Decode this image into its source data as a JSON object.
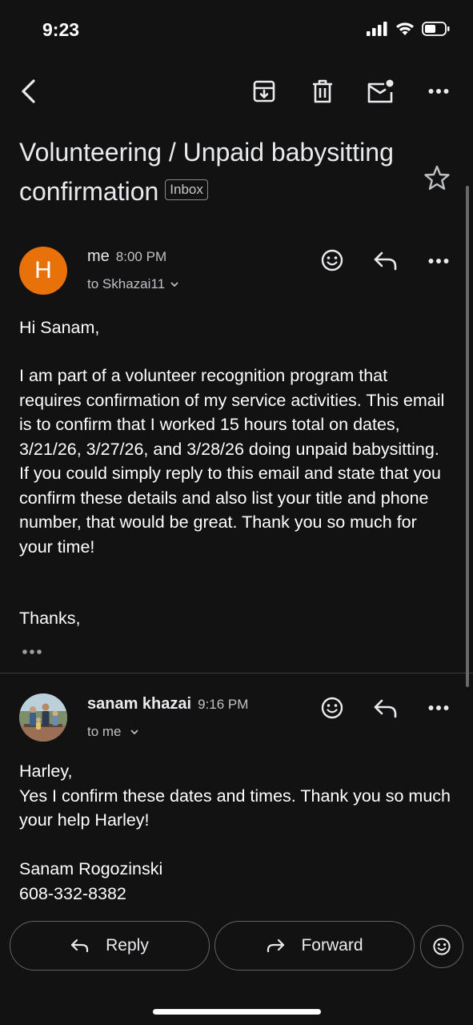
{
  "status_bar": {
    "time": "9:23"
  },
  "toolbar": {
    "icons": [
      "back-arrow-icon",
      "archive-icon",
      "trash-icon",
      "mark-unread-icon",
      "more-icon"
    ]
  },
  "subject": {
    "title": "Volunteering / Unpaid babysitting confirmation",
    "label_badge": "Inbox"
  },
  "messages": [
    {
      "avatar_letter": "H",
      "avatar_color": "#e8710a",
      "sender": "me",
      "time": "8:00 PM",
      "recipient": "to Skhazai11",
      "greeting": "Hi Sanam,",
      "body": "I am part of a volunteer recognition program that requires confirmation of my service activities. This email is to confirm that I worked 15 hours total on dates, 3/21/26, 3/27/26, and 3/28/26 doing unpaid babysitting. If you could simply reply to this email and state that you confirm these details and also list your title and phone number, that would be great. Thank you so much for your time!",
      "signoff": "Thanks,"
    },
    {
      "sender": "sanam khazai",
      "time": "9:16 PM",
      "recipient": "to me",
      "body": "Harley,\nYes I confirm these dates and times. Thank you so much your help Harley!\n\nSanam Rogozinski\n608-332-8382"
    }
  ],
  "actions": {
    "reply_label": "Reply",
    "forward_label": "Forward"
  },
  "colors": {
    "background": "#121212",
    "text": "#e8eaed",
    "accent_avatar": "#e8710a"
  }
}
